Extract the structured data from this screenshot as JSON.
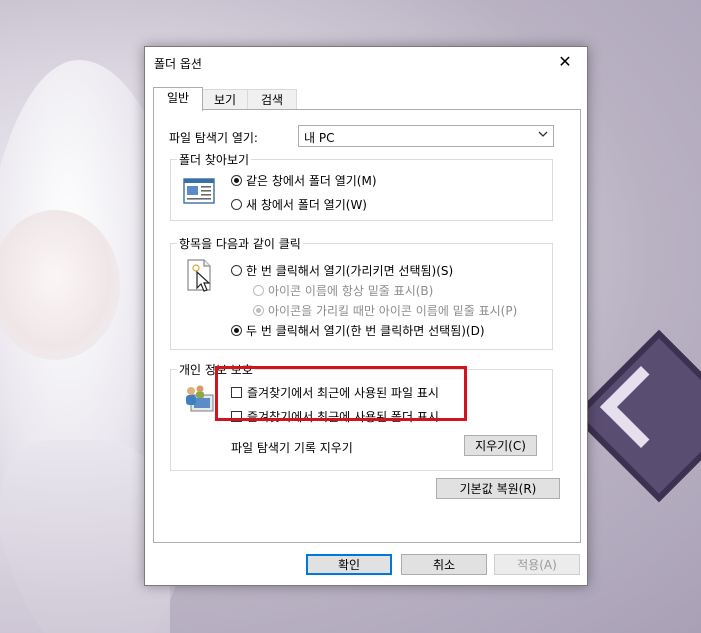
{
  "dialog": {
    "title": "폴더 옵션",
    "close_glyph": "✕",
    "tabs": [
      {
        "label": "일반",
        "active": true
      },
      {
        "label": "보기",
        "active": false
      },
      {
        "label": "검색",
        "active": false
      }
    ]
  },
  "general": {
    "open_explorer_label": "파일 탐색기 열기:",
    "open_explorer_value": "내 PC",
    "browse": {
      "title": "폴더 찾아보기",
      "opt_same": "같은 창에서 폴더 열기(M)",
      "opt_new": "새 창에서 폴더 열기(W)",
      "selected": "same"
    },
    "click": {
      "title": "항목을 다음과 같이 클릭",
      "opt_single": "한 번 클릭해서 열기(가리키면 선택됨)(S)",
      "opt_underline_always": "아이콘 이름에 항상 밑줄 표시(B)",
      "opt_underline_hover": "아이콘을 가리킬 때만 아이콘 이름에 밑줄 표시(P)",
      "opt_double": "두 번 클릭해서 열기(한 번 클릭하면 선택됨)(D)",
      "selected": "double"
    },
    "privacy": {
      "title": "개인 정보 보호",
      "show_recent_files": "즐겨찾기에서 최근에 사용된 파일 표시",
      "show_frequent_folders": "즐겨찾기에서 최근에 사용된 폴더 표시",
      "clear_history_label": "파일 탐색기 기록 지우기",
      "clear_button": "지우기(C)"
    },
    "restore_defaults": "기본값 복원(R)"
  },
  "footer": {
    "ok": "확인",
    "cancel": "취소",
    "apply": "적용(A)"
  },
  "colors": {
    "highlight_box": "#d3141d",
    "focus_border": "#0078d7"
  },
  "icons": {
    "browse": "folder-window-icon",
    "click": "pointer-click-icon",
    "privacy": "privacy-people-icon",
    "chevron": "chevron-down-icon"
  }
}
